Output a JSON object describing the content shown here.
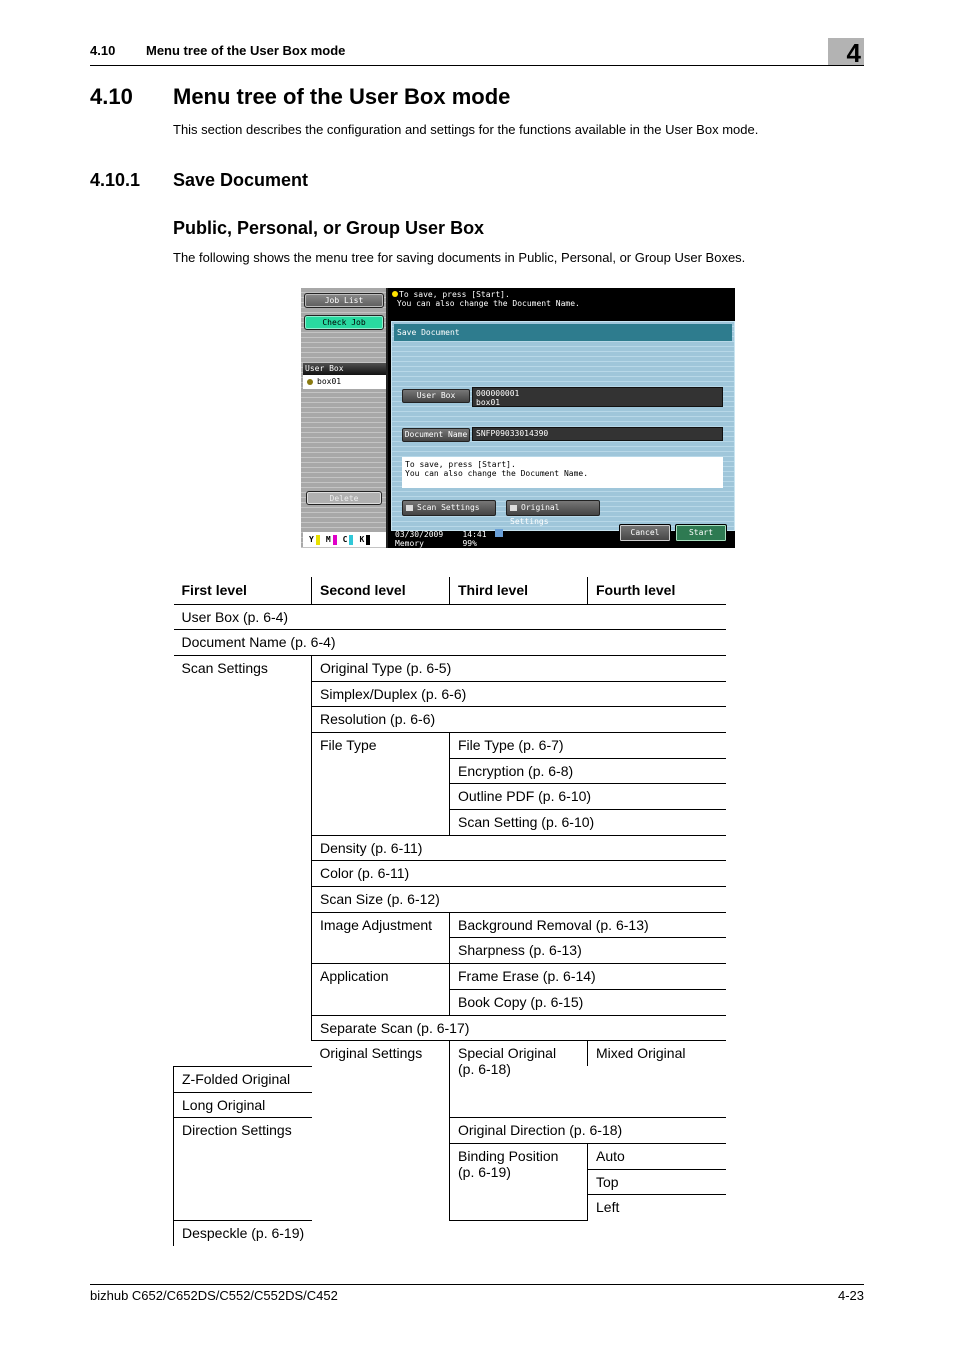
{
  "running_header": {
    "section_number": "4.10",
    "section_title": "Menu tree of the User Box mode",
    "chapter_number": "4"
  },
  "section": {
    "number": "4.10",
    "title": "Menu tree of the User Box mode",
    "intro": "This section describes the configuration and settings for the functions available in the User Box mode."
  },
  "subsection": {
    "number": "4.10.1",
    "title": "Save Document"
  },
  "subsubsection": {
    "title": "Public, Personal, or Group User Box",
    "intro": "The following shows the menu tree for saving documents in Public, Personal, or Group User Boxes."
  },
  "device_screen": {
    "job_list_button": "Job List",
    "check_job_button": "Check Job",
    "user_box_list_header": "User Box",
    "user_box_list_item": "box01",
    "delete_button": "Delete",
    "toner_labels": [
      "Y",
      "M",
      "C",
      "K"
    ],
    "toner_colors": [
      "#e8e000",
      "#e000c8",
      "#30c8d8",
      "#000000"
    ],
    "message_line1": "To save, press [Start].",
    "message_line2": " You can also change the Document Name.",
    "panel_title": "Save Document",
    "user_box_button": "User Box",
    "user_box_value_line1": "000000001",
    "user_box_value_line2": "box01",
    "document_name_button": "Document Name",
    "document_name_value": "SNFP09033014390",
    "info_line1": "To save, press [Start].",
    "info_line2": "You can also change the Document Name.",
    "scan_settings_button": "Scan Settings",
    "original_settings_button": "Original Settings",
    "date": "03/30/2009",
    "time": "14:41",
    "memory_label": "Memory",
    "memory_value": "99%",
    "cancel_button": "Cancel",
    "start_button": "Start"
  },
  "table": {
    "headers": [
      "First level",
      "Second level",
      "Third level",
      "Fourth level"
    ],
    "rows": {
      "user_box": "User Box (p. 6-4)",
      "document_name": "Document Name (p. 6-4)",
      "scan_settings": "Scan Settings",
      "original_type": "Original Type (p. 6-5)",
      "simplex_duplex": "Simplex/Duplex (p. 6-6)",
      "resolution": "Resolution (p. 6-6)",
      "file_type": "File Type",
      "file_type_page": "File Type (p. 6-7)",
      "encryption": "Encryption (p. 6-8)",
      "outline_pdf": "Outline PDF (p. 6-10)",
      "scan_setting": "Scan Setting (p. 6-10)",
      "density": "Density (p. 6-11)",
      "color": "Color (p. 6-11)",
      "scan_size": "Scan Size (p. 6-12)",
      "image_adjustment": "Image Adjustment",
      "background_removal": "Background Removal (p. 6-13)",
      "sharpness": "Sharpness (p. 6-13)",
      "application": "Application",
      "frame_erase": "Frame Erase (p. 6-14)",
      "book_copy": "Book Copy (p. 6-15)",
      "separate_scan": "Separate Scan (p. 6-17)",
      "original_settings": "Original Settings",
      "special_original_line1": "Special Original",
      "special_original_line2": "(p. 6-18)",
      "mixed_original": "Mixed Original",
      "z_folded_original": "Z-Folded Original",
      "long_original": "Long Original",
      "direction_settings": "Direction Settings",
      "original_direction": "Original Direction (p. 6-18)",
      "binding_position_line1": "Binding Position",
      "binding_position_line2": "(p. 6-19)",
      "auto": "Auto",
      "top": "Top",
      "left": "Left",
      "despeckle": "Despeckle (p. 6-19)"
    }
  },
  "footer": {
    "model": "bizhub C652/C652DS/C552/C552DS/C452",
    "page": "4-23"
  }
}
